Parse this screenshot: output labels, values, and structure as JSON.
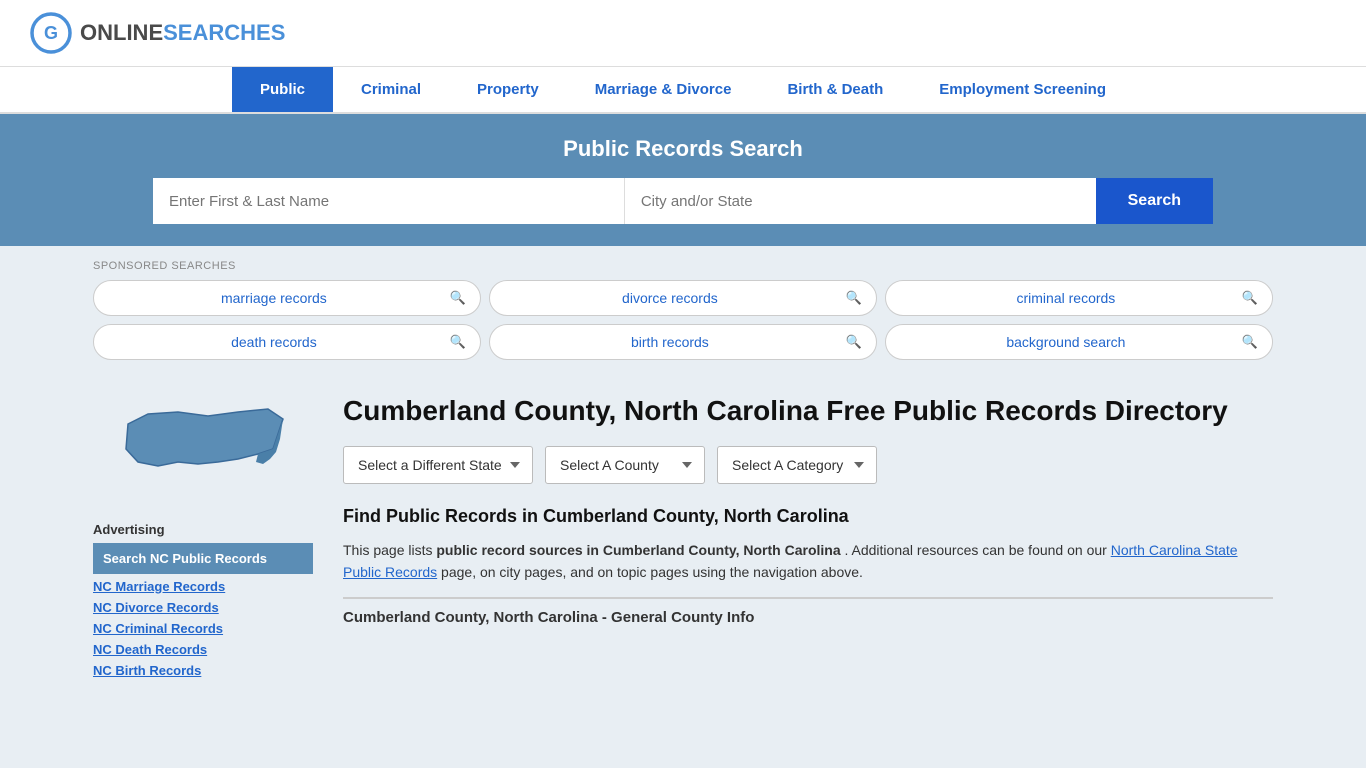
{
  "header": {
    "logo_online": "ONLINE",
    "logo_searches": "SEARCHES"
  },
  "nav": {
    "items": [
      {
        "label": "Public",
        "active": true
      },
      {
        "label": "Criminal",
        "active": false
      },
      {
        "label": "Property",
        "active": false
      },
      {
        "label": "Marriage & Divorce",
        "active": false
      },
      {
        "label": "Birth & Death",
        "active": false
      },
      {
        "label": "Employment Screening",
        "active": false
      }
    ]
  },
  "banner": {
    "title": "Public Records Search",
    "name_placeholder": "Enter First & Last Name",
    "location_placeholder": "City and/or State",
    "search_button": "Search"
  },
  "sponsored": {
    "label": "SPONSORED SEARCHES",
    "items": [
      {
        "text": "marriage records"
      },
      {
        "text": "divorce records"
      },
      {
        "text": "criminal records"
      },
      {
        "text": "death records"
      },
      {
        "text": "birth records"
      },
      {
        "text": "background search"
      }
    ]
  },
  "page": {
    "title": "Cumberland County, North Carolina Free Public Records Directory",
    "dropdowns": {
      "state": "Select a Different State",
      "county": "Select A County",
      "category": "Select A Category"
    },
    "find_title": "Find Public Records in Cumberland County, North Carolina",
    "body_text_1": "This page lists",
    "body_bold_1": "public record sources in Cumberland County, North Carolina",
    "body_text_2": ". Additional resources can be found on our",
    "link_text": "North Carolina State Public Records",
    "body_text_3": "page, on city pages, and on topic pages using the navigation above.",
    "county_info_header": "Cumberland County, North Carolina - General County Info"
  },
  "sidebar": {
    "ad_label": "Advertising",
    "ad_highlight": "Search NC Public Records",
    "links": [
      "NC Marriage Records",
      "NC Divorce Records",
      "NC Criminal Records",
      "NC Death Records",
      "NC Birth Records"
    ]
  }
}
